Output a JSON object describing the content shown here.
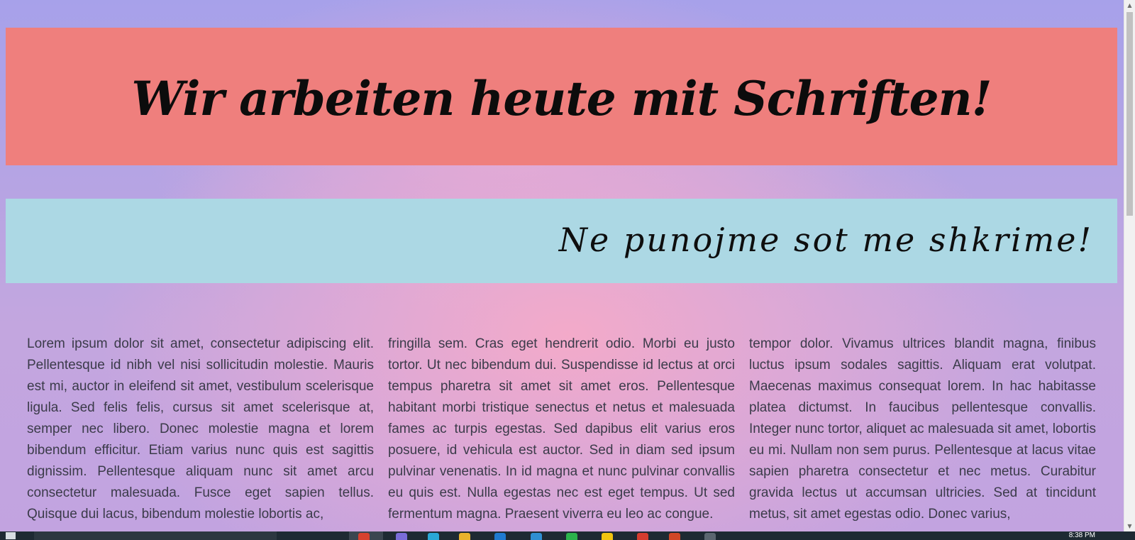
{
  "page": {
    "heading_primary": "Wir arbeiten heute mit Schriften!",
    "heading_secondary": "Ne punojme sot me shkrime!",
    "colors": {
      "primary_banner": "#ef7f7d",
      "secondary_banner": "#acd8e4",
      "background_gradient": [
        "#a7a1ea",
        "#f3a8c8",
        "#c2a3e0"
      ]
    }
  },
  "columns": [
    "Lorem ipsum dolor sit amet, consectetur adipiscing elit. Pellentesque id nibh vel nisi sollicitudin molestie. Mauris est mi, auctor in eleifend sit amet, vestibulum scelerisque ligula. Sed felis felis, cursus sit amet scelerisque at, semper nec libero. Donec molestie magna et lorem bibendum efficitur. Etiam varius nunc quis est sagittis dignissim. Pellentesque aliquam nunc sit amet arcu consectetur malesuada. Fusce eget sapien tellus. Quisque dui lacus, bibendum molestie lobortis ac,",
    "fringilla sem. Cras eget hendrerit odio. Morbi eu justo tortor. Ut nec bibendum dui. Suspendisse id lectus at orci tempus pharetra sit amet sit amet eros. Pellentesque habitant morbi tristique senectus et netus et malesuada fames ac turpis egestas. Sed dapibus elit varius eros posuere, id vehicula est auctor. Sed in diam sed ipsum pulvinar venenatis. In id magna et nunc pulvinar convallis eu quis est. Nulla egestas nec est eget tempus. Ut sed fermentum magna. Praesent viverra eu leo ac congue.",
    "tempor dolor. Vivamus ultrices blandit magna, finibus luctus ipsum sodales sagittis. Aliquam erat volutpat. Maecenas maximus consequat lorem. In hac habitasse platea dictumst. In faucibus pellentesque convallis. Integer nunc tortor, aliquet ac malesuada sit amet, lobortis eu mi. Nullam non sem purus. Pellentesque at lacus vitae sapien pharetra consectetur et nec metus. Curabitur gravida lectus ut accumsan ultricies. Sed at tincidunt metus, sit amet egestas odio. Donec varius,"
  ],
  "scrollbar": {
    "up_icon": "chevron-up-icon",
    "down_icon": "chevron-down-icon"
  },
  "taskbar": {
    "clock": "8:38 PM"
  }
}
